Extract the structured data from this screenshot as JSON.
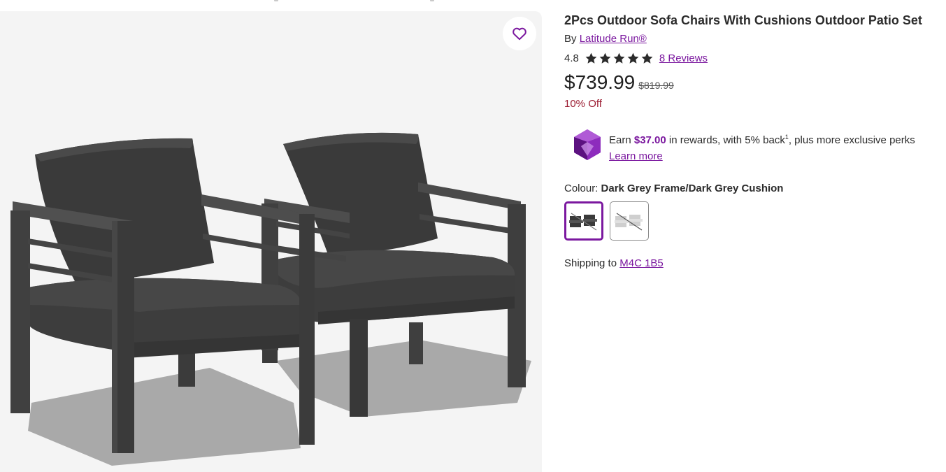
{
  "product": {
    "title": "2Pcs Outdoor Sofa Chairs With Cushions Outdoor Patio Set",
    "by_label": "By",
    "brand": "Latitude Run®",
    "rating": "4.8",
    "stars_filled": 5,
    "reviews_label": "8 Reviews",
    "price": "$739.99",
    "original_price": "$819.99",
    "discount": "10% Off"
  },
  "rewards": {
    "earn_prefix": "Earn",
    "amount": "$37.00",
    "middle_text": "in rewards, with 5% back",
    "superscript": "1",
    "suffix_text": ", plus more exclusive perks",
    "learn_more": "Learn more"
  },
  "colour": {
    "label": "Colour:",
    "selected": "Dark Grey Frame/Dark Grey Cushion",
    "options": [
      "Dark Grey Frame/Dark Grey Cushion",
      "Light Grey Frame/Light Grey Cushion"
    ]
  },
  "shipping": {
    "label": "Shipping to",
    "postal_code": "M4C 1B5"
  },
  "icons": {
    "favorite": "heart-icon",
    "rating": "star-icon",
    "rewards": "gem-icon"
  },
  "colors": {
    "accent": "#7b189f",
    "discount": "#9b1b30"
  }
}
